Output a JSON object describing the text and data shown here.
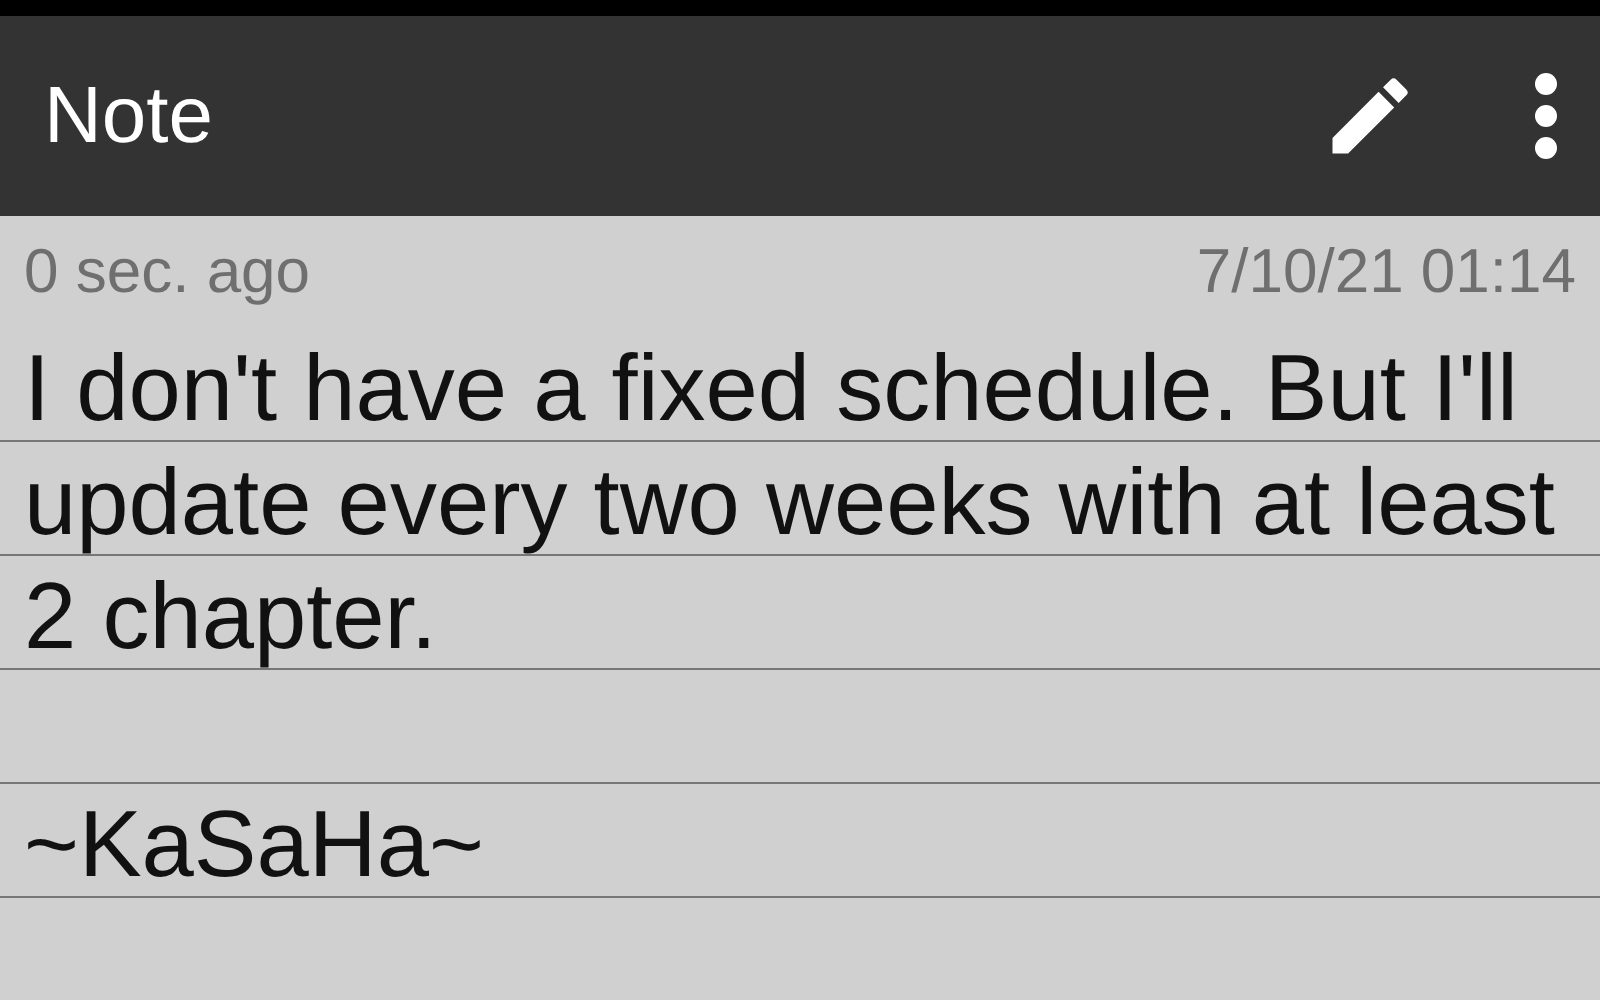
{
  "app_bar": {
    "title": "Note"
  },
  "meta": {
    "age": "0 sec. ago",
    "timestamp": "7/10/21 01:14"
  },
  "note": {
    "text": "I don't have a fixed schedule. But I'll update every two weeks with at least 2 chapter.\n\n~KaSaHa~"
  }
}
